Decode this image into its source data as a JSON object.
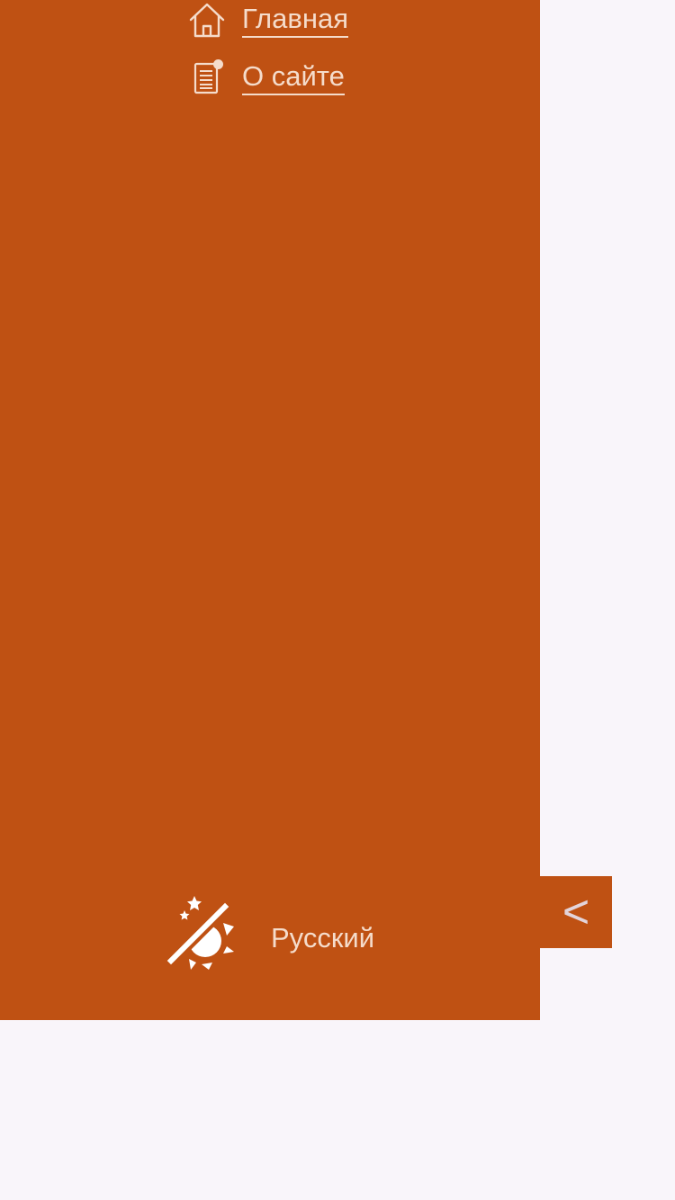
{
  "colors": {
    "page_background": "#f9f5fa",
    "sidebar_background": "#bf5113",
    "text": "#f5dccb",
    "collapse_glyph": "#e3d4da"
  },
  "sidebar": {
    "nav": [
      {
        "label": "Главная",
        "icon": "home-icon"
      },
      {
        "label": "О сайте",
        "icon": "document-icon"
      }
    ],
    "footer": {
      "theme_toggle_icon": "theme-auto-icon",
      "language": "Русский"
    }
  },
  "collapse_button": {
    "glyph": "<"
  }
}
